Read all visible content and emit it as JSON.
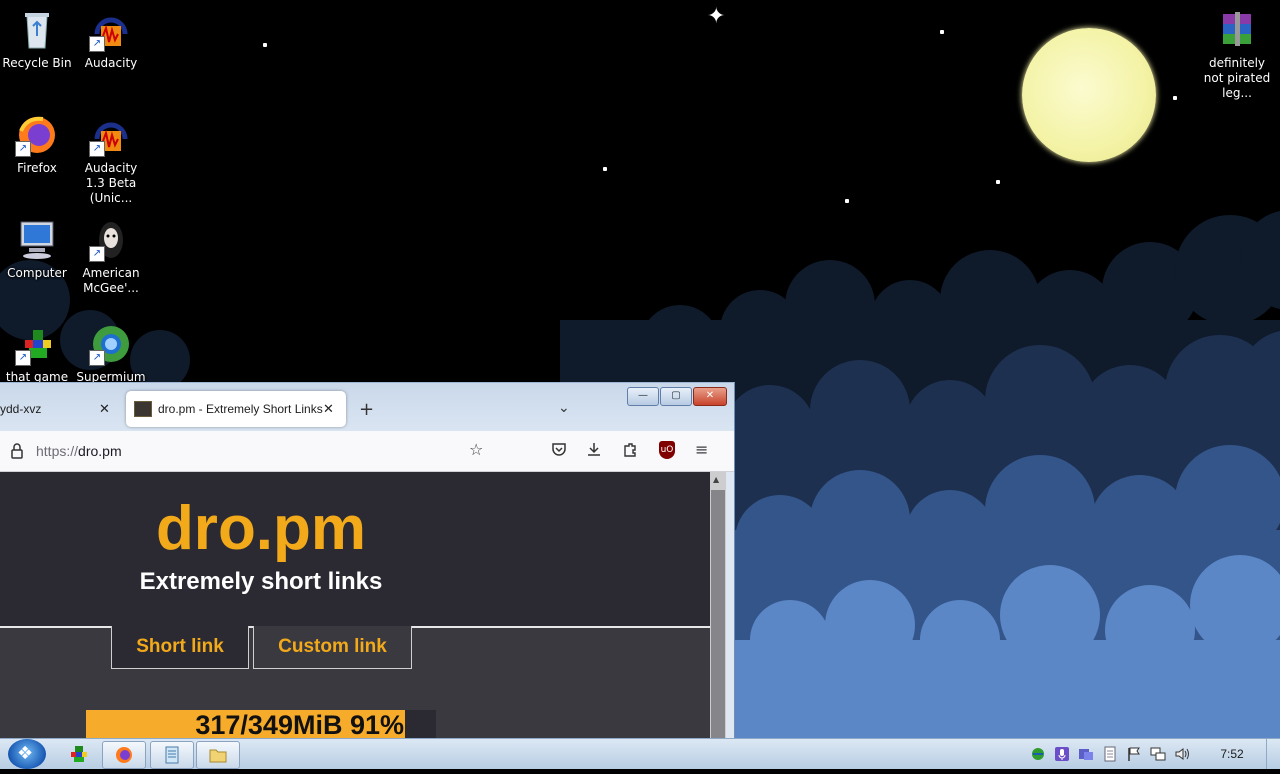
{
  "desktop": {
    "icons": [
      {
        "label": "Recycle Bin",
        "icon": "recycle-bin-icon"
      },
      {
        "label": "Audacity",
        "icon": "audacity-icon"
      },
      {
        "label": "Firefox",
        "icon": "firefox-icon"
      },
      {
        "label": "Audacity 1.3 Beta (Unic...",
        "icon": "audacity-icon"
      },
      {
        "label": "Computer",
        "icon": "computer-icon"
      },
      {
        "label": "American McGee'...",
        "icon": "game-icon"
      },
      {
        "label": "that game",
        "icon": "game-icon"
      },
      {
        "label": "Supermium",
        "icon": "browser-icon"
      },
      {
        "label": "definitely not pirated leg...",
        "icon": "winrar-archive-icon"
      }
    ]
  },
  "browser": {
    "tabs": [
      {
        "title": "ydd-xvz",
        "active": false
      },
      {
        "title": "dro.pm - Extremely Short Links",
        "active": true
      }
    ],
    "new_tab_symbol": "+",
    "close_symbol": "✕",
    "url_scheme": "https://",
    "url_host": "dro.pm",
    "window_buttons": {
      "minimize": "—",
      "maximize": "▢",
      "close": "✕"
    }
  },
  "page": {
    "logo": "dro.pm",
    "tagline": "Extremely short links",
    "tabs": [
      "Short link",
      "Custom link"
    ],
    "selected_tab": "Short link",
    "upload_progress": {
      "text": "317/349MiB 91%",
      "fraction": 0.91
    }
  },
  "taskbar": {
    "clock": "7:52",
    "pinned": [
      "game-icon",
      "firefox-icon",
      "notepad-icon",
      "explorer-icon"
    ]
  },
  "colors": {
    "accent": "#f2a91a",
    "page_bg": "#2b2a33",
    "progress_fill": "#f6ac2a"
  }
}
